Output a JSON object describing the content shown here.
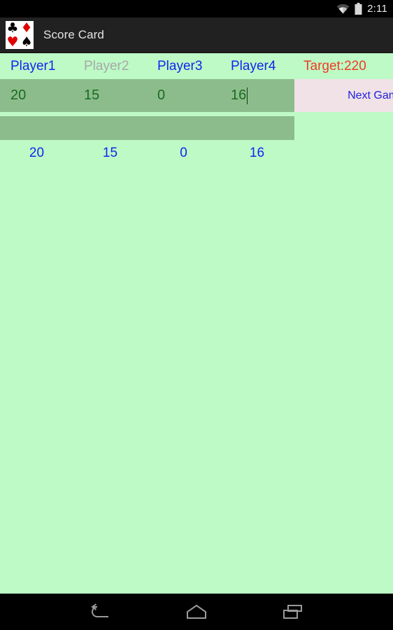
{
  "status_bar": {
    "time": "2:11",
    "wifi_icon": "wifi-icon",
    "battery_icon": "battery-icon"
  },
  "action_bar": {
    "title": "Score Card",
    "app_icon": {
      "name": "card-suits-icon",
      "suits": [
        "♣",
        "♦",
        "♥",
        "♠"
      ]
    }
  },
  "columns": {
    "headers": [
      {
        "label": "Player1",
        "disabled": false
      },
      {
        "label": "Player2",
        "disabled": true
      },
      {
        "label": "Player3",
        "disabled": false
      },
      {
        "label": "Player4",
        "disabled": false
      }
    ],
    "target": "Target:220"
  },
  "score_rows": [
    {
      "values": [
        "20",
        "15",
        "0",
        "16"
      ],
      "focused_index": 3
    },
    {
      "values": [
        "",
        "",
        "",
        ""
      ],
      "focused_index": -1
    }
  ],
  "totals": [
    "20",
    "15",
    "0",
    "16"
  ],
  "next_game": {
    "label": "Next Game"
  },
  "nav_bar": {
    "back": "back-icon",
    "home": "home-icon",
    "recents": "recents-icon"
  },
  "colors": {
    "background": "#bdfac6",
    "input_row": "#8cbc8c",
    "action_bar": "#212121",
    "player_blue": "#1026f0",
    "player_disabled": "#a8a8a8",
    "target_red": "#ef3b21",
    "input_text": "#1a6b23",
    "next_game_bg": "#f0e2e6",
    "next_game_text": "#2020e0"
  }
}
